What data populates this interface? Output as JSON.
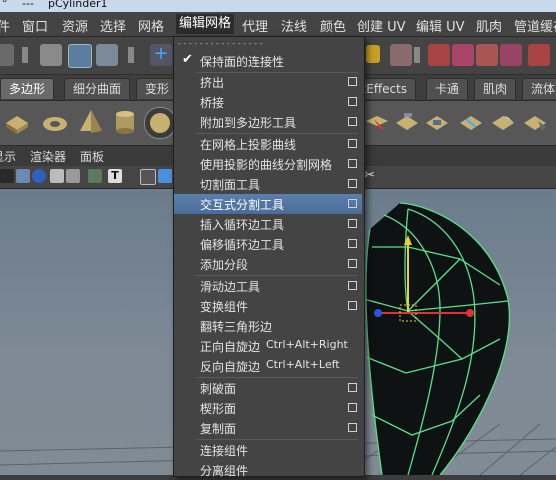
{
  "title": {
    "lead": "°",
    "sep": "---",
    "file": "pCylinder1"
  },
  "menubar": {
    "items": [
      "文件",
      "窗口",
      "资源",
      "选择",
      "网格",
      "编辑网格",
      "代理",
      "法线",
      "颜色",
      "创建 UV",
      "编辑 UV",
      "肌肉",
      "管道缓存"
    ]
  },
  "shelf_tabs": [
    "多边形",
    "细分曲面",
    "变形",
    "ntEffects",
    "卡通",
    "肌肉",
    "流体"
  ],
  "panel_menu": [
    "显示",
    "渲染器",
    "面板"
  ],
  "panel_toolbar": {
    "text_icon": "T"
  },
  "dropdown": {
    "tearoff": "- - - - - - - - - - - - - - - -",
    "items": [
      {
        "label": "保持面的连接性",
        "checked": true
      },
      {
        "label": "挤出",
        "option": true
      },
      {
        "label": "桥接",
        "option": true
      },
      {
        "label": "附加到多边形工具",
        "option": true
      },
      {
        "label": "在网格上投影曲线",
        "option": true
      },
      {
        "label": "使用投影的曲线分割网格",
        "option": true
      },
      {
        "label": "切割面工具",
        "option": true
      },
      {
        "label": "交互式分割工具",
        "option": true,
        "highlighted": true
      },
      {
        "label": "插入循环边工具",
        "option": true
      },
      {
        "label": "偏移循环边工具",
        "option": true
      },
      {
        "label": "添加分段",
        "option": true
      },
      {
        "label": "滑动边工具",
        "option": true
      },
      {
        "label": "变换组件",
        "option": true
      },
      {
        "label": "翻转三角形边"
      },
      {
        "label": "正向自旋边",
        "shortcut": "Ctrl+Alt+Right"
      },
      {
        "label": "反向自旋边",
        "shortcut": "Ctrl+Alt+Left"
      },
      {
        "label": "刺破面",
        "option": true
      },
      {
        "label": "楔形面",
        "option": true
      },
      {
        "label": "复制面",
        "option": true
      },
      {
        "label": "连接组件"
      },
      {
        "label": "分离组件"
      }
    ]
  },
  "colors": {
    "highlight": "#4f73a3",
    "wireframe": "#59e08a",
    "menu_bg": "#444444"
  }
}
